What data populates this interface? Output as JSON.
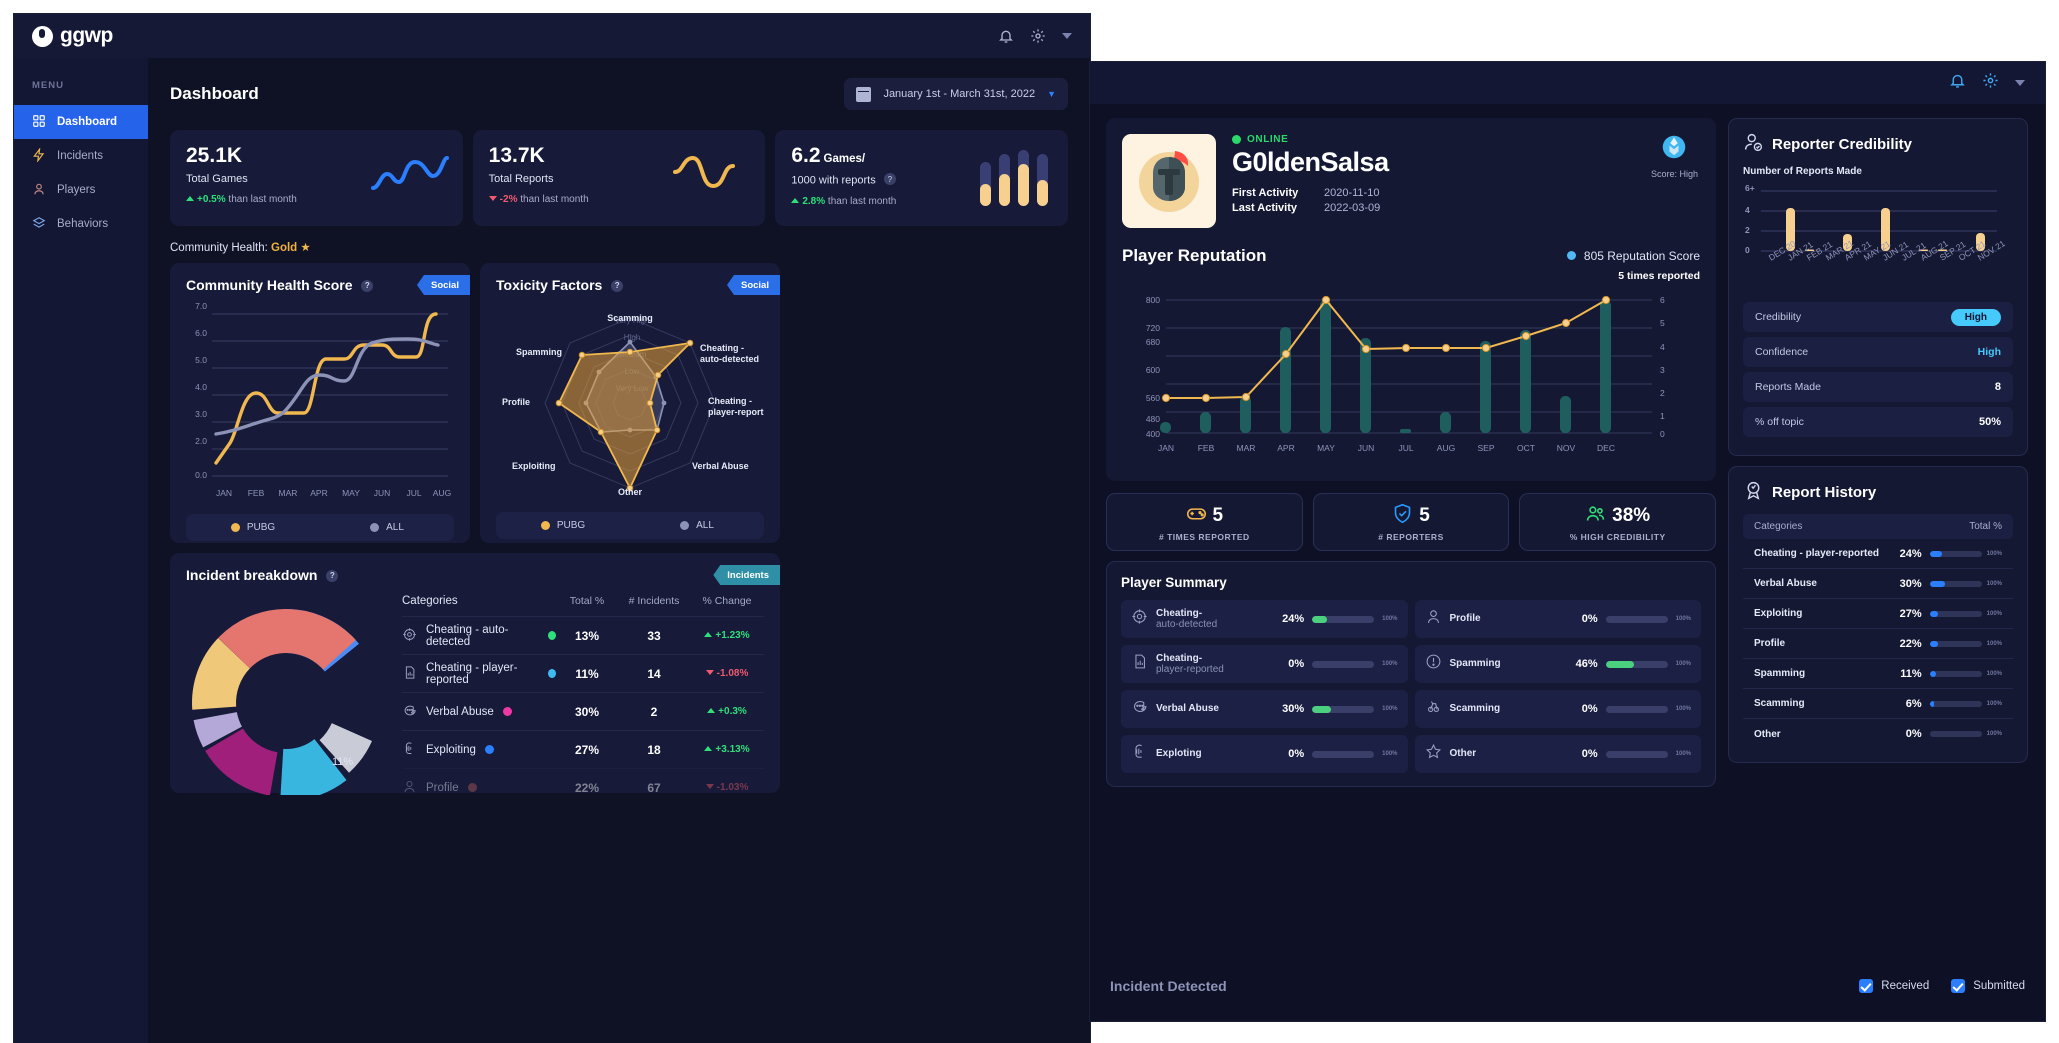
{
  "dashboard": {
    "brand": "ggwp",
    "menu_label": "MENU",
    "nav": [
      {
        "label": "Dashboard",
        "icon": "grid-icon",
        "active": true
      },
      {
        "label": "Incidents",
        "icon": "bolt-icon",
        "active": false
      },
      {
        "label": "Players",
        "icon": "person-icon",
        "active": false
      },
      {
        "label": "Behaviors",
        "icon": "layers-icon",
        "active": false
      }
    ],
    "page_title": "Dashboard",
    "date_range": "January 1st - March 31st, 2022",
    "stats": [
      {
        "value": "25.1K",
        "unit": "",
        "label": "Total Games",
        "delta": "+0.5%",
        "delta_suffix": "than last month",
        "dir": "up",
        "spark": "line-blue"
      },
      {
        "value": "13.7K",
        "unit": "",
        "label": "Total Reports",
        "delta": "-2%",
        "delta_suffix": "than last month",
        "dir": "down",
        "spark": "line-yellow"
      },
      {
        "value": "6.2",
        "unit": "Games/",
        "label": "1000 with reports",
        "delta": "2.8%",
        "delta_suffix": "than last month",
        "dir": "up",
        "spark": "bars"
      }
    ],
    "community_health_line": "Community Health:",
    "community_health_tier": "Gold",
    "panels": {
      "chs": {
        "title": "Community Health Score",
        "ribbon": "Social",
        "legend": [
          {
            "label": "PUBG",
            "color": "#f0b84f"
          },
          {
            "label": "ALL",
            "color": "#8d93b6"
          }
        ]
      },
      "toxicity": {
        "title": "Toxicity Factors",
        "ribbon": "Social",
        "legend": [
          {
            "label": "PUBG",
            "color": "#f0b84f"
          },
          {
            "label": "ALL",
            "color": "#8d93b6"
          }
        ]
      },
      "incident": {
        "title": "Incident breakdown",
        "ribbon": "Incidents",
        "donut_label": "11%"
      }
    },
    "incident_table": {
      "headers": [
        "Categories",
        "Total %",
        "# Incidents",
        "% Change"
      ],
      "rows": [
        {
          "cat": "Cheating - auto-detected",
          "dot": "#2ee07a",
          "total": "13%",
          "count": "33",
          "change": "+1.23%",
          "dir": "up",
          "icon": "target-icon"
        },
        {
          "cat": "Cheating - player-reported",
          "dot": "#3fb9f0",
          "total": "11%",
          "count": "14",
          "change": "-1.08%",
          "dir": "down",
          "icon": "report-icon"
        },
        {
          "cat": "Verbal Abuse",
          "dot": "#f038a5",
          "total": "30%",
          "count": "2",
          "change": "+0.3%",
          "dir": "up",
          "icon": "chat-icon"
        },
        {
          "cat": "Exploiting",
          "dot": "#2b7fff",
          "total": "27%",
          "count": "18",
          "change": "+3.13%",
          "dir": "up",
          "icon": "brain-icon"
        },
        {
          "cat": "Profile",
          "dot": "#b05c5c",
          "total": "22%",
          "count": "67",
          "change": "-1.03%",
          "dir": "down",
          "icon": "person-icon"
        }
      ]
    }
  },
  "player": {
    "status": "ONLINE",
    "name": "G0ldenSalsa",
    "first_activity_label": "First Activity",
    "first_activity": "2020-11-10",
    "last_activity_label": "Last Activity",
    "last_activity": "2022-03-09",
    "score_badge_label": "Score: High",
    "reputation_title": "Player Reputation",
    "reputation_score": "805",
    "reputation_score_suffix": "Reputation Score",
    "times_reported_note": "5 times reported",
    "kpis": [
      {
        "value": "5",
        "label": "# TIMES REPORTED",
        "icon": "gamepad-icon",
        "color": "#f0b84f"
      },
      {
        "value": "5",
        "label": "# REPORTERS",
        "icon": "shield-check-icon",
        "color": "#2b9cff"
      },
      {
        "value": "38%",
        "label": "% HIGH CREDIBILITY",
        "icon": "people-icon",
        "color": "#2ee07a"
      }
    ],
    "summary_title": "Player Summary",
    "summary": [
      {
        "name": "Cheating-",
        "name2": "auto-detected",
        "pct": "24%",
        "fill": 24,
        "icon": "target-icon"
      },
      {
        "name": "Profile",
        "name2": "",
        "pct": "0%",
        "fill": 0,
        "icon": "person-icon"
      },
      {
        "name": "Cheating-",
        "name2": "player-reported",
        "pct": "0%",
        "fill": 0,
        "icon": "report-icon"
      },
      {
        "name": "Spamming",
        "name2": "",
        "pct": "46%",
        "fill": 46,
        "icon": "alert-icon"
      },
      {
        "name": "Verbal Abuse",
        "name2": "",
        "pct": "30%",
        "fill": 30,
        "icon": "chat-icon"
      },
      {
        "name": "Scamming",
        "name2": "",
        "pct": "0%",
        "fill": 0,
        "icon": "scam-icon"
      },
      {
        "name": "Exploting",
        "name2": "",
        "pct": "0%",
        "fill": 0,
        "icon": "brain-icon"
      },
      {
        "name": "Other",
        "name2": "",
        "pct": "0%",
        "fill": 0,
        "icon": "star-icon"
      }
    ],
    "summary_bar_max": "100%",
    "credibility": {
      "title": "Reporter Credibility",
      "subtitle": "Number of Reports Made",
      "rows": [
        {
          "k": "Credibility",
          "v": "High",
          "type": "pill"
        },
        {
          "k": "Confidence",
          "v": "High",
          "type": "blue"
        },
        {
          "k": "Reports Made",
          "v": "8",
          "type": "plain"
        },
        {
          "k": "% off topic",
          "v": "50%",
          "type": "plain"
        }
      ]
    },
    "report_history": {
      "title": "Report History",
      "headers": [
        "Categories",
        "Total %"
      ],
      "bar_max": "100%",
      "rows": [
        {
          "cat": "Cheating - player-reported",
          "pct": "24%",
          "fill": 24
        },
        {
          "cat": "Verbal Abuse",
          "pct": "30%",
          "fill": 30
        },
        {
          "cat": "Exploiting",
          "pct": "27%",
          "fill": 27
        },
        {
          "cat": "Profile",
          "pct": "22%",
          "fill": 22
        },
        {
          "cat": "Spamming",
          "pct": "11%",
          "fill": 11
        },
        {
          "cat": "Scamming",
          "pct": "6%",
          "fill": 6
        },
        {
          "cat": "Other",
          "pct": "0%",
          "fill": 0
        }
      ]
    },
    "footer": {
      "incident_detected": "Incident Detected",
      "received": "Received",
      "submitted": "Submitted"
    }
  },
  "chart_data": [
    {
      "type": "line",
      "title": "Community Health Score",
      "xlabel": "",
      "ylabel": "",
      "categories": [
        "JAN",
        "FEB",
        "MAR",
        "APR",
        "MAY",
        "JUN",
        "JUL",
        "AUG"
      ],
      "yticks": [
        0.0,
        2.0,
        3.0,
        4.0,
        5.0,
        6.0,
        7.0
      ],
      "ylim": [
        0,
        7
      ],
      "series": [
        {
          "name": "PUBG",
          "color": "#f0b84f",
          "values": [
            1.5,
            3.95,
            3.4,
            3.4,
            5.75,
            5.5,
            5.35,
            6.9
          ]
        },
        {
          "name": "ALL",
          "color": "#8d93b6",
          "values": [
            2.15,
            2.4,
            2.65,
            4.5,
            4.45,
            5.85,
            6.05,
            5.9
          ]
        }
      ]
    },
    {
      "type": "radar",
      "title": "Toxicity Factors",
      "categories": [
        "Scamming",
        "Cheating - auto-detected",
        "Cheating - player-report",
        "Verbal Abuse",
        "Other",
        "Exploiting",
        "Profile",
        "Spamming"
      ],
      "rings": [
        "Very Low",
        "Low",
        "Medium",
        "High",
        "Very High"
      ],
      "series": [
        {
          "name": "PUBG",
          "color": "#f0b84f",
          "values": [
            3,
            5,
            2.3,
            1.5,
            2.8,
            2.4,
            4.2,
            4.0
          ]
        },
        {
          "name": "ALL",
          "color": "#8d93b6",
          "values": [
            3.6,
            2.2,
            2.8,
            2.2,
            1.6,
            2.4,
            2.6,
            2.6
          ]
        }
      ]
    },
    {
      "type": "pie",
      "title": "Incident breakdown",
      "labels": [
        "Cheating - auto-detected",
        "Cheating - player-reported",
        "Verbal Abuse",
        "Exploiting",
        "Profile",
        "Other"
      ],
      "values": [
        13,
        11,
        30,
        27,
        22,
        8
      ],
      "colors": [
        "#4b8bf5",
        "#c9ccd6",
        "#38b6e0",
        "#a01f7a",
        "#b4a8d8",
        "#f0c87a"
      ],
      "highlight_label": "11%"
    },
    {
      "type": "bar",
      "title": "Player Reputation",
      "categories": [
        "JAN",
        "FEB",
        "MAR",
        "APR",
        "MAY",
        "JUN",
        "JUL",
        "AUG",
        "SEP",
        "OCT",
        "NOV",
        "DEC"
      ],
      "yticks": [
        400,
        480,
        560,
        600,
        680,
        720,
        800
      ],
      "ylim": [
        400,
        800
      ],
      "y2ticks": [
        0,
        1,
        2,
        3,
        4,
        5,
        6
      ],
      "y2lim": [
        0,
        6
      ],
      "series": [
        {
          "name": "Reports",
          "type": "bar",
          "color": "#1d6060",
          "values": [
            0.15,
            0.85,
            2.05,
            4.9,
            6.0,
            4.4,
            0.05,
            0.9,
            4.35,
            4.8,
            2.0,
            6.0
          ]
        },
        {
          "name": "Reputation",
          "type": "line",
          "color": "#f0b84f",
          "values": [
            563,
            563,
            565,
            685,
            800,
            693,
            694,
            694,
            694,
            712,
            745,
            800
          ]
        }
      ]
    },
    {
      "type": "bar",
      "title": "Number of Reports Made",
      "categories": [
        "DEC 20",
        "JAN 21",
        "FEB 21",
        "MAR 21",
        "APR 21",
        "MAY 21",
        "JUN 21",
        "JUL 21",
        "AUG 21",
        "SEP 21",
        "OCT 21",
        "NOV 21"
      ],
      "values": [
        0,
        4.3,
        0.05,
        0,
        1.7,
        0,
        4.3,
        0,
        0.08,
        0.08,
        0,
        1.8
      ],
      "yticks": [
        "0",
        "2",
        "4",
        "6+"
      ],
      "ylim": [
        0,
        6
      ],
      "color": "#f7cf8e"
    }
  ]
}
